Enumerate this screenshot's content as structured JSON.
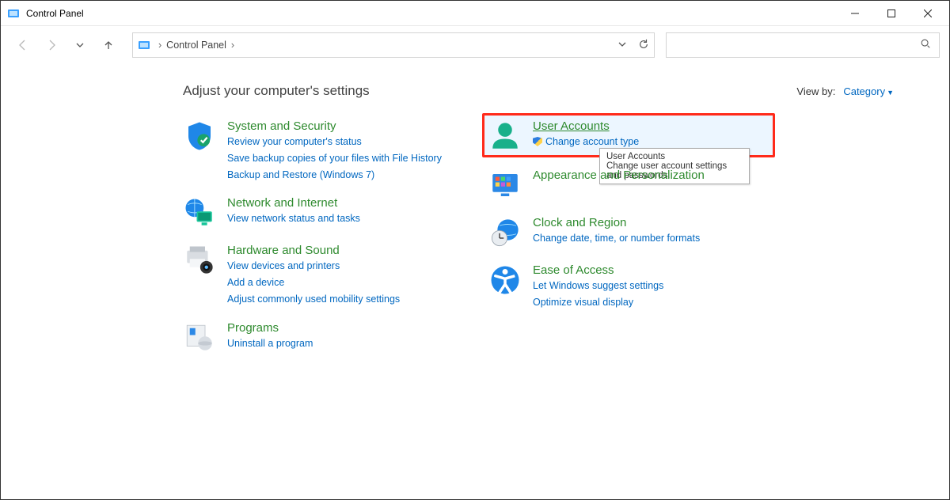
{
  "window": {
    "title": "Control Panel"
  },
  "address": {
    "location": "Control Panel"
  },
  "header": {
    "heading": "Adjust your computer's settings",
    "view_by_label": "View by:",
    "view_by_value": "Category"
  },
  "left": {
    "system": {
      "title": "System and Security",
      "links": [
        "Review your computer's status",
        "Save backup copies of your files with File History",
        "Backup and Restore (Windows 7)"
      ]
    },
    "network": {
      "title": "Network and Internet",
      "links": [
        "View network status and tasks"
      ]
    },
    "hardware": {
      "title": "Hardware and Sound",
      "links": [
        "View devices and printers",
        "Add a device",
        "Adjust commonly used mobility settings"
      ]
    },
    "programs": {
      "title": "Programs",
      "links": [
        "Uninstall a program"
      ]
    }
  },
  "right": {
    "user": {
      "title": "User Accounts",
      "links": [
        "Change account type"
      ]
    },
    "appearance": {
      "title": "Appearance and Personalization"
    },
    "clock": {
      "title": "Clock and Region",
      "links": [
        "Change date, time, or number formats"
      ]
    },
    "ease": {
      "title": "Ease of Access",
      "links": [
        "Let Windows suggest settings",
        "Optimize visual display"
      ]
    }
  },
  "tooltip": {
    "title": "User Accounts",
    "body": "Change user account settings and passwords."
  }
}
